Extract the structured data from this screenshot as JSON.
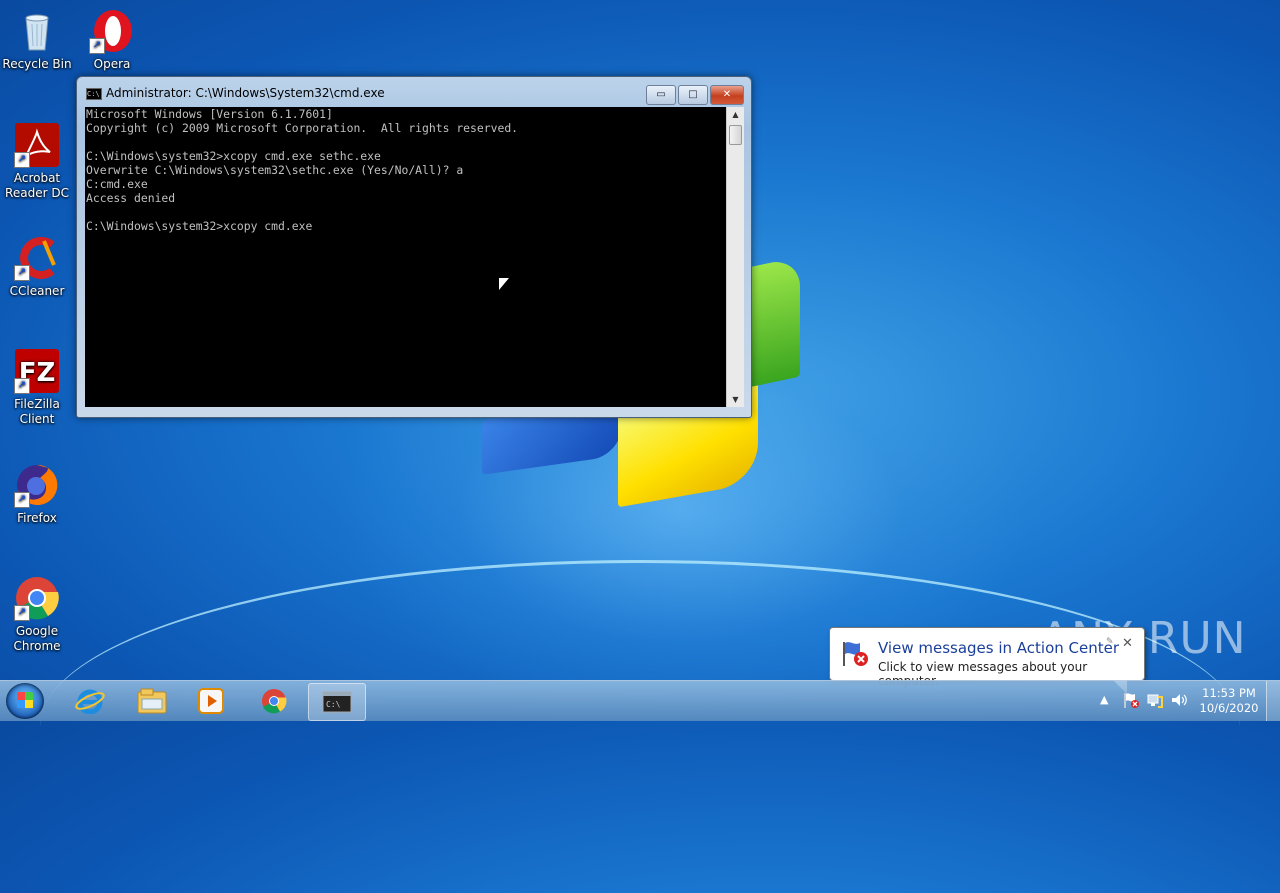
{
  "desktop": {
    "icons": [
      {
        "label": "Recycle Bin",
        "icon": "recycle-bin-icon"
      },
      {
        "label": "Opera",
        "icon": "opera-icon"
      },
      {
        "label": "Acrobat Reader DC",
        "icon": "acrobat-icon"
      },
      {
        "label": "CCleaner",
        "icon": "ccleaner-icon"
      },
      {
        "label": "FileZilla Client",
        "icon": "filezilla-icon"
      },
      {
        "label": "Firefox",
        "icon": "firefox-icon"
      },
      {
        "label": "Google Chrome",
        "icon": "chrome-icon"
      }
    ]
  },
  "cmd_window": {
    "title": "Administrator: C:\\Windows\\System32\\cmd.exe",
    "buttons": {
      "minimize": "▭",
      "maximize": "□",
      "close": "✕"
    },
    "console_lines": [
      "Microsoft Windows [Version 6.1.7601]",
      "Copyright (c) 2009 Microsoft Corporation.  All rights reserved.",
      "",
      "C:\\Windows\\system32>xcopy cmd.exe sethc.exe",
      "Overwrite C:\\Windows\\system32\\sethc.exe (Yes/No/All)? a",
      "C:cmd.exe",
      "Access denied",
      "",
      "C:\\Windows\\system32>xcopy cmd.exe"
    ]
  },
  "notification": {
    "title": "View messages in Action Center",
    "message": "Click to view messages about your computer.",
    "close": "✕"
  },
  "taskbar": {
    "items": [
      "Internet Explorer",
      "Windows Explorer",
      "Windows Media Player",
      "Google Chrome",
      "Command Prompt"
    ],
    "clock_time": "11:53 PM",
    "clock_date": "10/6/2020",
    "tray_expand": "▲"
  },
  "watermark": "ANY RUN"
}
